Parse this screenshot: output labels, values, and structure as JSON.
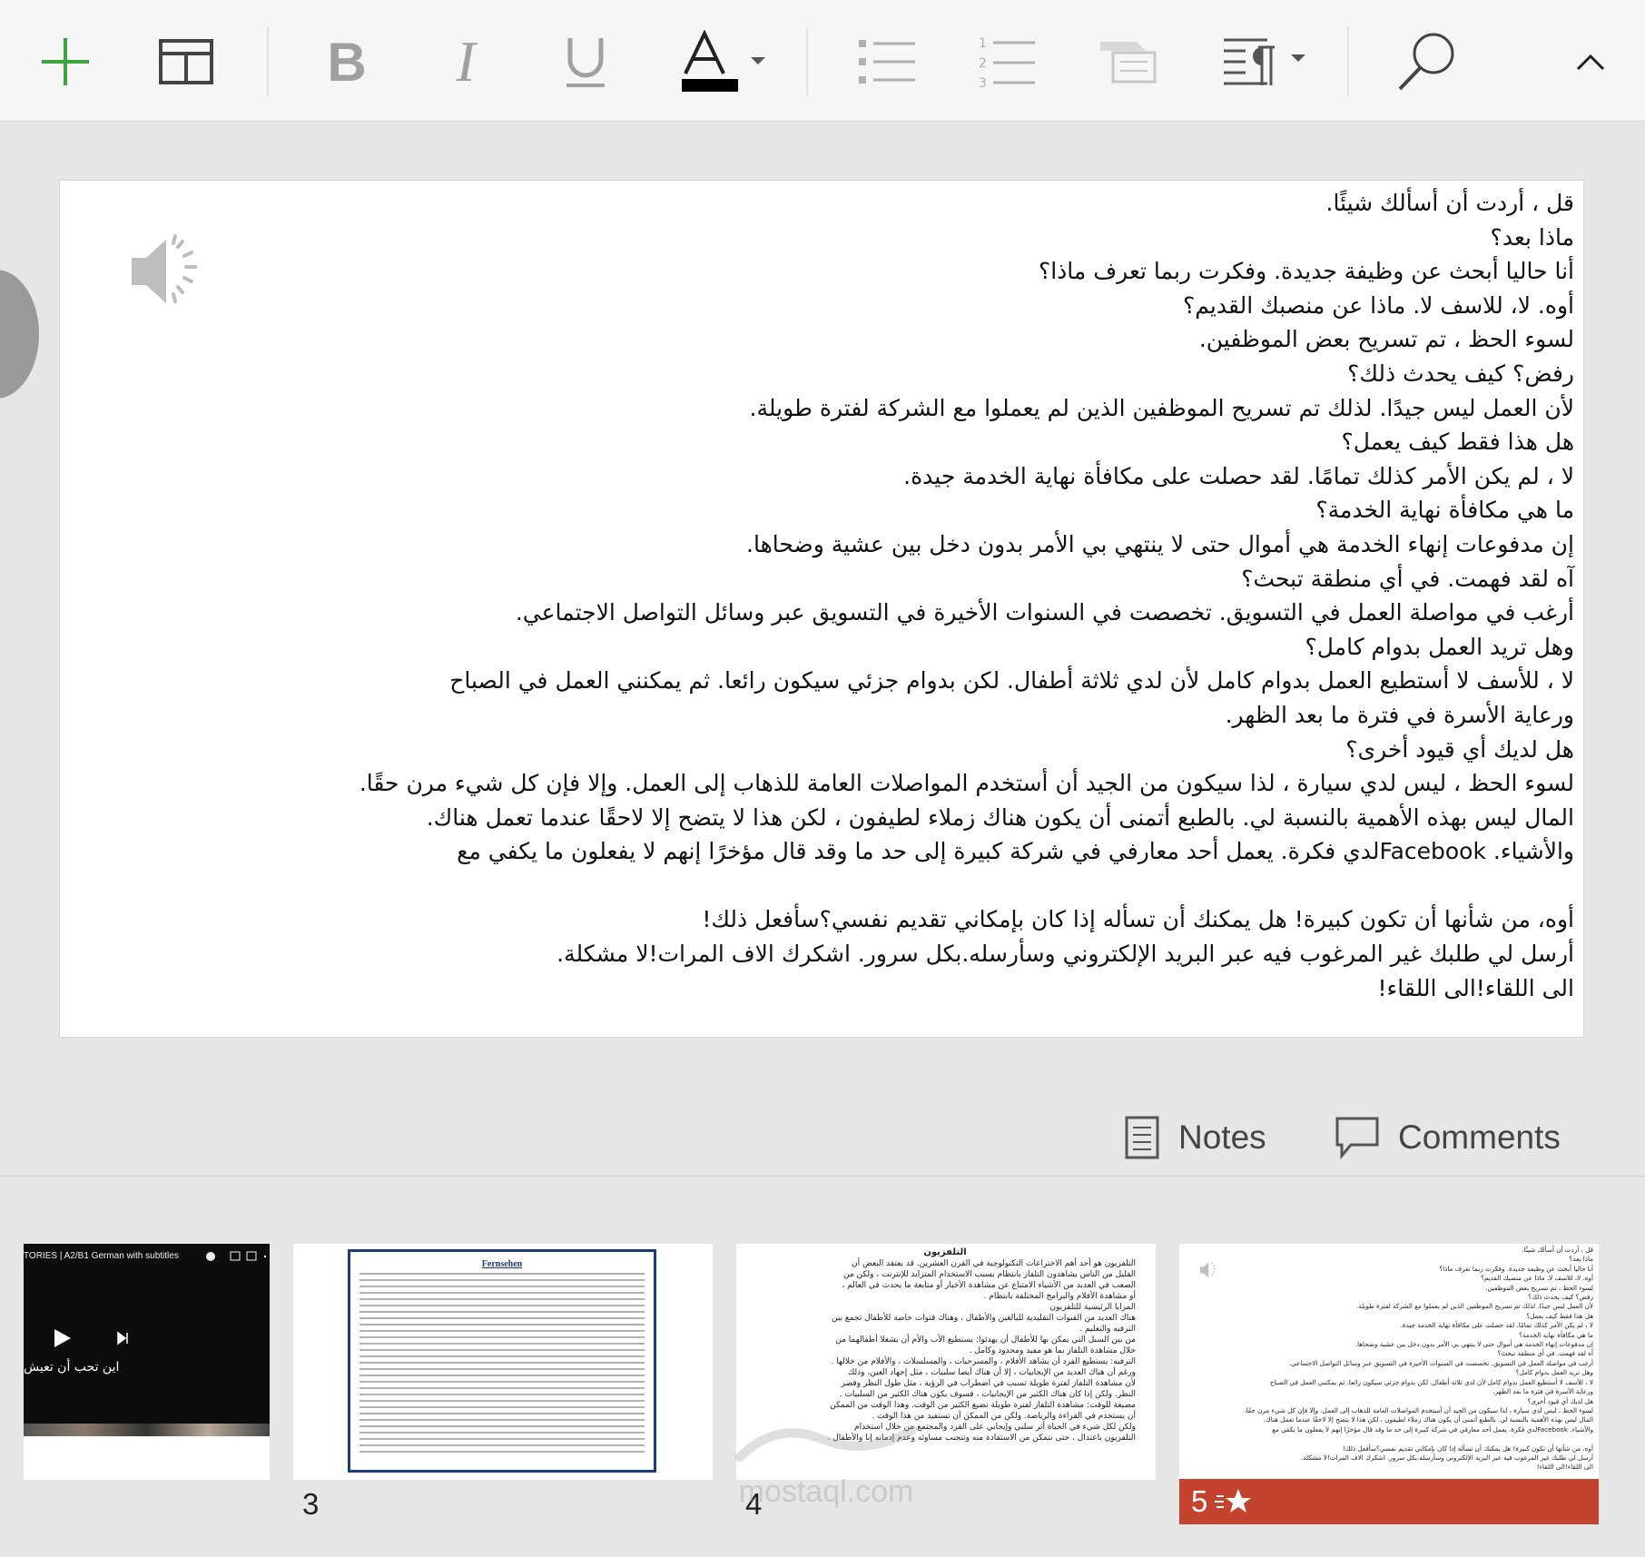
{
  "toolbar": {
    "buttons": [
      "new-slide",
      "layout",
      "bold",
      "italic",
      "underline",
      "font-color",
      "bullets",
      "numbering",
      "comment-box",
      "paragraph",
      "find",
      "collapse"
    ],
    "font_color": "#000000"
  },
  "slide": {
    "lines": [
      "قل ، أردت أن أسألك شيئًا.",
      "ماذا بعد؟",
      "أنا حاليا أبحث عن وظيفة جديدة. وفكرت ربما تعرف ماذا؟",
      "أوه. لا، للاسف لا. ماذا عن منصبك القديم؟",
      "لسوء الحظ ، تم تسريح بعض الموظفين.",
      "رفض؟ كيف يحدث ذلك؟",
      "لأن العمل ليس جيدًا. لذلك تم تسريح الموظفين الذين لم يعملوا مع الشركة لفترة طويلة.",
      "هل هذا فقط كيف يعمل؟",
      "لا ، لم يكن الأمر كذلك تمامًا. لقد حصلت على مكافأة نهاية الخدمة جيدة.",
      "ما هي مكافأة نهاية الخدمة؟",
      "إن مدفوعات إنهاء الخدمة هي أموال حتى لا ينتهي بي الأمر بدون دخل بين عشية وضحاها.",
      "آه لقد فهمت. في أي منطقة تبحث؟",
      "أرغب في مواصلة العمل في التسويق. تخصصت في السنوات الأخيرة في التسويق عبر وسائل التواصل الاجتماعي.",
      "وهل تريد العمل بدوام كامل؟",
      "لا ، للأسف لا أستطيع العمل بدوام كامل لأن لدي ثلاثة أطفال. لكن بدوام جزئي سيكون رائعا. ثم يمكنني العمل في الصباح",
      "ورعاية الأسرة في فترة ما بعد الظهر.",
      "هل لديك أي قيود أخرى؟",
      "لسوء الحظ ، ليس لدي سيارة ، لذا سيكون من الجيد أن أستخدم المواصلات العامة للذهاب إلى العمل. وإلا فإن كل شيء مرن حقًا.",
      "المال ليس بهذه الأهمية بالنسبة لي. بالطبع أتمنى أن يكون هناك زملاء لطيفون ، لكن هذا لا يتضح إلا لاحقًا عندما تعمل هناك.",
      "والأشياء. Facebookلدي فكرة. يعمل أحد معارفي في شركة كبيرة إلى حد ما وقد قال مؤخرًا إنهم لا يفعلون ما يكفي مع",
      "",
      "أوه، من شأنها أن تكون كبيرة! هل يمكنك أن تسأله إذا كان بإمكاني تقديم نفسي؟سأفعل ذلك!",
      " أرسل لي طلبك غير المرغوب فيه عبر البريد الإلكتروني وسأرسله.بكل سرور. اشكرك الاف المرات!لا مشكلة.",
      " الى اللقاء!الى اللقاء!"
    ]
  },
  "notes_label": "Notes",
  "comments_label": "Comments",
  "thumbnails": {
    "video_title": "TORIES | A2/B1 German with subtitles",
    "video_caption": "اين تحب أن تعيش",
    "t3_number": "3",
    "t3_heading": "Fernsehen",
    "t4_number": "4",
    "t4_title": "التلفزيون",
    "t4_lines": [
      "التلفزيون هو أحد أهم الاختراعات التكنولوجية في القرن العشرين. قد يعتقد البعض أن",
      "القليل من الناس يشاهدون التلفاز بانتظام بسبب الاستخدام المتزايد للإنترنت ، ولكن من",
      "الصعب في العديد من الأشياء الامتناع عن مشاهدة الأخبار أو متابعة ما يحدث في العالم ،",
      "أو مشاهدة الأفلام والبرامج المختلفة بانتظام .",
      "المزايا الرئيسية للتلفزيون",
      "هناك العديد من القنوات التقليدية للبالغين والأطفال ، وهناك قنوات خاصة للأطفال تجمع بين",
      "الترفيه والتعليم .",
      "من بين السبل التي يمكن بها للأطفال أن يهدئوا: يستطيع الأب والأم أن يشغلا أطفالهما من",
      "خلال مشاهدة التلفاز بما هو مفيد ومحدود وكامل .",
      "الترفيه: يستطيع الفرد أن يشاهد الأفلام ، والمسرحيات ، والمسلسلات ، والأفلام من خلالها .",
      "ورغم أن هناك العديد من الإيجابيات ، إلا أن هناك أيضا سلبيات ، مثل إجهاد العين، وذلك",
      "لأن مشاهدة التلفاز لفترة طويلة تسبب في اضطراب في الرؤية ، مثل طول النظر وقصر",
      "النظر. ولكن إذا كان هناك الكثير من الإيجابيات ، فسوف يكون هناك الكثير من السلبيات .",
      "مضيعة للوقت: مشاهدة التلفاز لفترة طويلة تضيع الكثير من الوقت. وهذا الوقت من الممكن",
      "أن يستخدم في القراءة والرياضة. ولكن من الممكن أن تستفيد من هذا الوقت .",
      "ولكن لكل شيء في الحياة أثر سلبي وإيجابي على الفرد والمجتمع من خلال استخدام",
      "التلفزيون باعتدال ، حتى نتمكن من الاستفادة منه ونتجنب مساوئه وعدم إدمانه إنا والأطفال ."
    ],
    "t5_number": "5",
    "t5_badge_icon": "star-transition-icon"
  },
  "watermark_text": "mostaql.com",
  "colors": {
    "accent": "#c4432f",
    "plus_green": "#3da33d",
    "toolbar_bg": "#f6f6f6",
    "canvas_bg": "#e6e6e6"
  }
}
